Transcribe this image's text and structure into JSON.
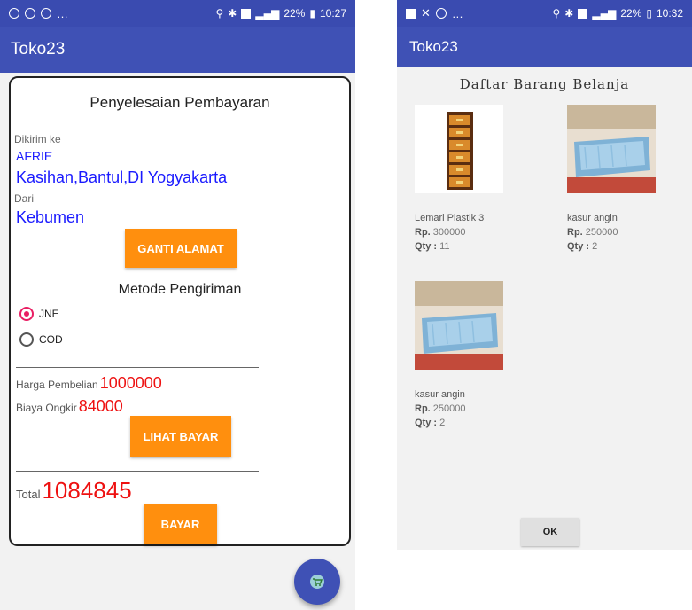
{
  "phone1": {
    "status": {
      "time": "10:27",
      "battery": "22%"
    },
    "app_title": "Toko23",
    "dialog_title": "Penyelesaian Pembayaran",
    "shipping": {
      "to_label": "Dikirim ke",
      "recipient": "AFRIE",
      "address": "Kasihan,Bantul,DI Yogyakarta",
      "from_label": "Dari",
      "origin": "Kebumen",
      "change_button": "GANTI ALAMAT"
    },
    "method": {
      "title": "Metode Pengiriman",
      "options": [
        {
          "label": "JNE",
          "checked": true
        },
        {
          "label": "COD",
          "checked": false
        }
      ]
    },
    "prices": {
      "purchase_label": "Harga Pembelian",
      "purchase_value": "1000000",
      "shipping_label": "Biaya Ongkir",
      "shipping_value": "84000",
      "view_button": "LIHAT BAYAR",
      "total_label": "Total",
      "total_value": "1084845",
      "pay_button": "BAYAR"
    }
  },
  "phone2": {
    "status": {
      "time": "10:32",
      "battery": "22%"
    },
    "app_title": "Toko23",
    "dialog_title": "Daftar Barang Belanja",
    "items": [
      {
        "name": "Lemari Plastik 3",
        "price_label": "Rp.",
        "price": "300000",
        "qty_label": "Qty :",
        "qty": "11"
      },
      {
        "name": "kasur angin",
        "price_label": "Rp.",
        "price": "250000",
        "qty_label": "Qty :",
        "qty": "2"
      },
      {
        "name": "kasur angin",
        "price_label": "Rp.",
        "price": "250000",
        "qty_label": "Qty :",
        "qty": "2"
      }
    ],
    "ok_button": "OK"
  }
}
